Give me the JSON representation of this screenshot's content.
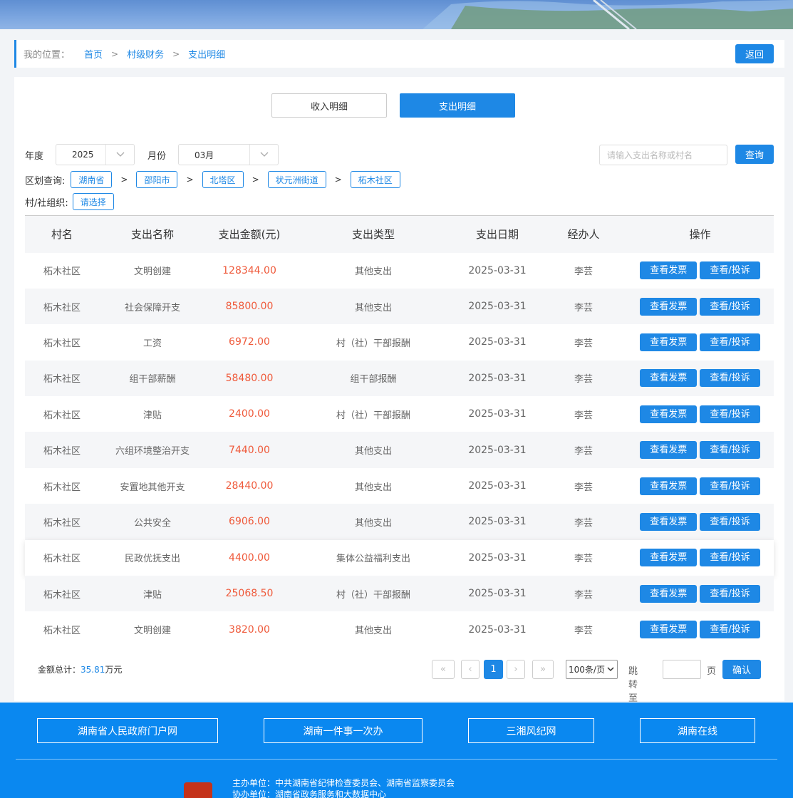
{
  "breadcrumb": {
    "label": "我的位置：",
    "items": [
      "首页",
      "村级财务",
      "支出明细"
    ],
    "separator": ">",
    "back_label": "返回"
  },
  "tabs": {
    "income": "收入明细",
    "expense": "支出明细"
  },
  "filters": {
    "year_label": "年度",
    "year_value": "2025",
    "month_label": "月份",
    "month_value": "03月",
    "search_placeholder": "请输入支出名称或村名",
    "query_label": "查询",
    "region_label": "区划查询:",
    "region_items": [
      "湖南省",
      "邵阳市",
      "北塔区",
      "状元洲街道",
      "柘木社区"
    ],
    "org_label": "村/社组织:",
    "org_value": "请选择"
  },
  "table": {
    "headers": [
      "村名",
      "支出名称",
      "支出金额(元)",
      "支出类型",
      "支出日期",
      "经办人",
      "操作"
    ],
    "action_labels": [
      "查看发票",
      "查看/投诉"
    ],
    "rows": [
      [
        "柘木社区",
        "文明创建",
        "128344.00",
        "其他支出",
        "2025-03-31",
        "李芸"
      ],
      [
        "柘木社区",
        "社会保障开支",
        "85800.00",
        "其他支出",
        "2025-03-31",
        "李芸"
      ],
      [
        "柘木社区",
        "工资",
        "6972.00",
        "村（社）干部报酬",
        "2025-03-31",
        "李芸"
      ],
      [
        "柘木社区",
        "组干部薪酬",
        "58480.00",
        "组干部报酬",
        "2025-03-31",
        "李芸"
      ],
      [
        "柘木社区",
        "津贴",
        "2400.00",
        "村（社）干部报酬",
        "2025-03-31",
        "李芸"
      ],
      [
        "柘木社区",
        "六组环境整治开支",
        "7440.00",
        "其他支出",
        "2025-03-31",
        "李芸"
      ],
      [
        "柘木社区",
        "安置地其他开支",
        "28440.00",
        "其他支出",
        "2025-03-31",
        "李芸"
      ],
      [
        "柘木社区",
        "公共安全",
        "6906.00",
        "其他支出",
        "2025-03-31",
        "李芸"
      ],
      [
        "柘木社区",
        "民政优抚支出",
        "4400.00",
        "集体公益福利支出",
        "2025-03-31",
        "李芸"
      ],
      [
        "柘木社区",
        "津贴",
        "25068.50",
        "村（社）干部报酬",
        "2025-03-31",
        "李芸"
      ],
      [
        "柘木社区",
        "文明创建",
        "3820.00",
        "其他支出",
        "2025-03-31",
        "李芸"
      ]
    ]
  },
  "summary": {
    "label": "金额总计：",
    "value": "35.81",
    "unit": "万元"
  },
  "pager": {
    "first": "«",
    "prev": "‹",
    "current": "1",
    "next": "›",
    "last": "»",
    "page_size": "100条/页",
    "jump_label": "跳转至",
    "page_unit": "页",
    "confirm": "确认"
  },
  "footer": {
    "links": [
      "湖南省人民政府门户网",
      "湖南一件事一次办",
      "三湘风纪网",
      "湖南在线"
    ],
    "sponsor": "主办单位：中共湖南省纪律检查委员会、湖南省监察委员会",
    "co_sponsor": "协办单位：湖南省政务服务和大数据中心"
  },
  "colors": {
    "accent": "#1e88e5",
    "amount": "#ef5a3b",
    "footer_bg": "#0a88f0"
  }
}
